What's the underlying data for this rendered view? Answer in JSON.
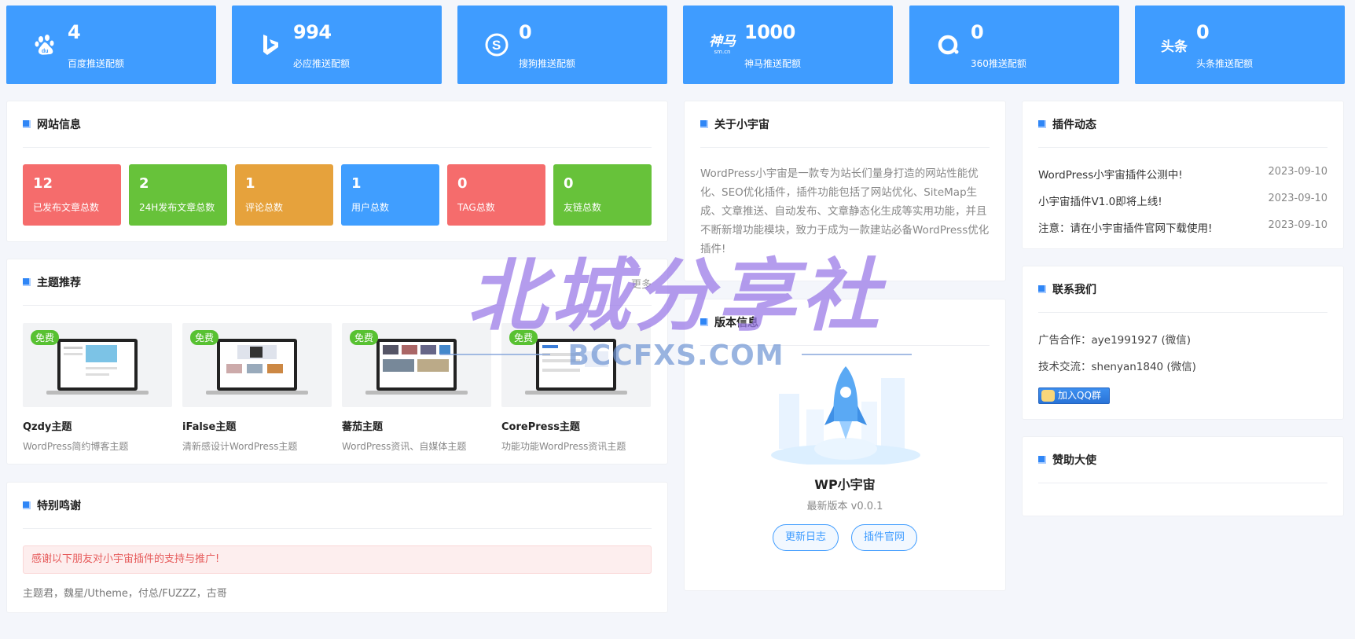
{
  "stats": [
    {
      "value": "4",
      "label": "百度推送配额",
      "icon": "baidu-icon"
    },
    {
      "value": "994",
      "label": "必应推送配额",
      "icon": "bing-icon"
    },
    {
      "value": "0",
      "label": "搜狗推送配额",
      "icon": "sogou-icon"
    },
    {
      "value": "1000",
      "label": "神马推送配额",
      "icon": "shenma-icon",
      "icon_text": "神马",
      "icon_sub": "sm.cn"
    },
    {
      "value": "0",
      "label": "360推送配额",
      "icon": "360-icon"
    },
    {
      "value": "0",
      "label": "头条推送配额",
      "icon": "toutiao-icon",
      "icon_text": "头条"
    }
  ],
  "site_info": {
    "title": "网站信息",
    "tiles": [
      {
        "value": "12",
        "label": "已发布文章总数",
        "color": "#f56c6c"
      },
      {
        "value": "2",
        "label": "24H发布文章总数",
        "color": "#67c23a"
      },
      {
        "value": "1",
        "label": "评论总数",
        "color": "#e6a23c"
      },
      {
        "value": "1",
        "label": "用户总数",
        "color": "#409eff"
      },
      {
        "value": "0",
        "label": "TAG总数",
        "color": "#f56c6c"
      },
      {
        "value": "0",
        "label": "友链总数",
        "color": "#67c23a"
      }
    ]
  },
  "themes": {
    "title": "主题推荐",
    "more": "更多",
    "items": [
      {
        "badge": "免费",
        "name": "Qzdy主题",
        "desc": "WordPress简约博客主题"
      },
      {
        "badge": "免费",
        "name": "iFalse主题",
        "desc": "清新感设计WordPress主题"
      },
      {
        "badge": "免费",
        "name": "蕃茄主题",
        "desc": "WordPress资讯、自媒体主题"
      },
      {
        "badge": "免费",
        "name": "CorePress主题",
        "desc": "功能功能WordPress资讯主题"
      }
    ]
  },
  "thanks": {
    "title": "特别鸣谢",
    "notice": "感谢以下朋友对小宇宙插件的支持与推广!",
    "names": "主题君，魏星/Utheme，付总/FUZZZ，古哥"
  },
  "about": {
    "title": "关于小宇宙",
    "text": "WordPress小宇宙是一款专为站长们量身打造的网站性能优化、SEO优化插件，插件功能包括了网站优化、SiteMap生成、文章推送、自动发布、文章静态化生成等实用功能，并且不断新增功能模块，致力于成为一款建站必备WordPress优化插件!"
  },
  "version": {
    "title": "版本信息",
    "product": "WP小宇宙",
    "latest": "最新版本 v0.0.1",
    "changelog_btn": "更新日志",
    "site_btn": "插件官网"
  },
  "news": {
    "title": "插件动态",
    "items": [
      {
        "text": "WordPress小宇宙插件公测中!",
        "date": "2023-09-10"
      },
      {
        "text": "小宇宙插件V1.0即将上线!",
        "date": "2023-09-10"
      },
      {
        "text": "注意：请在小宇宙插件官网下载使用!",
        "date": "2023-09-10"
      }
    ]
  },
  "contact": {
    "title": "联系我们",
    "ad": "广告合作：aye1991927 (微信)",
    "tech": "技术交流：shenyan1840 (微信)",
    "qq_btn": "加入QQ群"
  },
  "sponsor": {
    "title": "赞助大使"
  },
  "watermark": {
    "title": "北城分享社",
    "sub": "BCCFXS.COM"
  }
}
